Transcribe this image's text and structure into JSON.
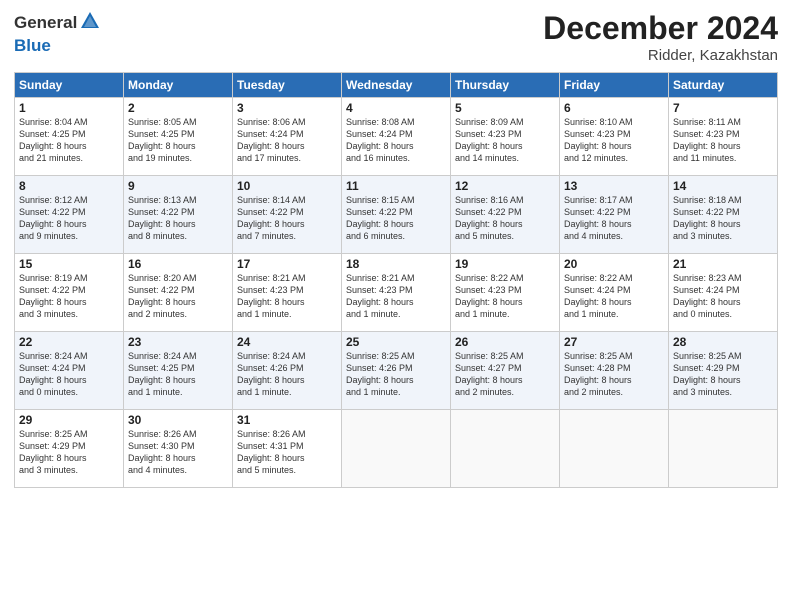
{
  "header": {
    "logo_line1": "General",
    "logo_line2": "Blue",
    "month": "December 2024",
    "location": "Ridder, Kazakhstan"
  },
  "weekdays": [
    "Sunday",
    "Monday",
    "Tuesday",
    "Wednesday",
    "Thursday",
    "Friday",
    "Saturday"
  ],
  "weeks": [
    [
      {
        "day": "1",
        "info": "Sunrise: 8:04 AM\nSunset: 4:25 PM\nDaylight: 8 hours\nand 21 minutes."
      },
      {
        "day": "2",
        "info": "Sunrise: 8:05 AM\nSunset: 4:25 PM\nDaylight: 8 hours\nand 19 minutes."
      },
      {
        "day": "3",
        "info": "Sunrise: 8:06 AM\nSunset: 4:24 PM\nDaylight: 8 hours\nand 17 minutes."
      },
      {
        "day": "4",
        "info": "Sunrise: 8:08 AM\nSunset: 4:24 PM\nDaylight: 8 hours\nand 16 minutes."
      },
      {
        "day": "5",
        "info": "Sunrise: 8:09 AM\nSunset: 4:23 PM\nDaylight: 8 hours\nand 14 minutes."
      },
      {
        "day": "6",
        "info": "Sunrise: 8:10 AM\nSunset: 4:23 PM\nDaylight: 8 hours\nand 12 minutes."
      },
      {
        "day": "7",
        "info": "Sunrise: 8:11 AM\nSunset: 4:23 PM\nDaylight: 8 hours\nand 11 minutes."
      }
    ],
    [
      {
        "day": "8",
        "info": "Sunrise: 8:12 AM\nSunset: 4:22 PM\nDaylight: 8 hours\nand 9 minutes."
      },
      {
        "day": "9",
        "info": "Sunrise: 8:13 AM\nSunset: 4:22 PM\nDaylight: 8 hours\nand 8 minutes."
      },
      {
        "day": "10",
        "info": "Sunrise: 8:14 AM\nSunset: 4:22 PM\nDaylight: 8 hours\nand 7 minutes."
      },
      {
        "day": "11",
        "info": "Sunrise: 8:15 AM\nSunset: 4:22 PM\nDaylight: 8 hours\nand 6 minutes."
      },
      {
        "day": "12",
        "info": "Sunrise: 8:16 AM\nSunset: 4:22 PM\nDaylight: 8 hours\nand 5 minutes."
      },
      {
        "day": "13",
        "info": "Sunrise: 8:17 AM\nSunset: 4:22 PM\nDaylight: 8 hours\nand 4 minutes."
      },
      {
        "day": "14",
        "info": "Sunrise: 8:18 AM\nSunset: 4:22 PM\nDaylight: 8 hours\nand 3 minutes."
      }
    ],
    [
      {
        "day": "15",
        "info": "Sunrise: 8:19 AM\nSunset: 4:22 PM\nDaylight: 8 hours\nand 3 minutes."
      },
      {
        "day": "16",
        "info": "Sunrise: 8:20 AM\nSunset: 4:22 PM\nDaylight: 8 hours\nand 2 minutes."
      },
      {
        "day": "17",
        "info": "Sunrise: 8:21 AM\nSunset: 4:23 PM\nDaylight: 8 hours\nand 1 minute."
      },
      {
        "day": "18",
        "info": "Sunrise: 8:21 AM\nSunset: 4:23 PM\nDaylight: 8 hours\nand 1 minute."
      },
      {
        "day": "19",
        "info": "Sunrise: 8:22 AM\nSunset: 4:23 PM\nDaylight: 8 hours\nand 1 minute."
      },
      {
        "day": "20",
        "info": "Sunrise: 8:22 AM\nSunset: 4:24 PM\nDaylight: 8 hours\nand 1 minute."
      },
      {
        "day": "21",
        "info": "Sunrise: 8:23 AM\nSunset: 4:24 PM\nDaylight: 8 hours\nand 0 minutes."
      }
    ],
    [
      {
        "day": "22",
        "info": "Sunrise: 8:24 AM\nSunset: 4:24 PM\nDaylight: 8 hours\nand 0 minutes."
      },
      {
        "day": "23",
        "info": "Sunrise: 8:24 AM\nSunset: 4:25 PM\nDaylight: 8 hours\nand 1 minute."
      },
      {
        "day": "24",
        "info": "Sunrise: 8:24 AM\nSunset: 4:26 PM\nDaylight: 8 hours\nand 1 minute."
      },
      {
        "day": "25",
        "info": "Sunrise: 8:25 AM\nSunset: 4:26 PM\nDaylight: 8 hours\nand 1 minute."
      },
      {
        "day": "26",
        "info": "Sunrise: 8:25 AM\nSunset: 4:27 PM\nDaylight: 8 hours\nand 2 minutes."
      },
      {
        "day": "27",
        "info": "Sunrise: 8:25 AM\nSunset: 4:28 PM\nDaylight: 8 hours\nand 2 minutes."
      },
      {
        "day": "28",
        "info": "Sunrise: 8:25 AM\nSunset: 4:29 PM\nDaylight: 8 hours\nand 3 minutes."
      }
    ],
    [
      {
        "day": "29",
        "info": "Sunrise: 8:25 AM\nSunset: 4:29 PM\nDaylight: 8 hours\nand 3 minutes."
      },
      {
        "day": "30",
        "info": "Sunrise: 8:26 AM\nSunset: 4:30 PM\nDaylight: 8 hours\nand 4 minutes."
      },
      {
        "day": "31",
        "info": "Sunrise: 8:26 AM\nSunset: 4:31 PM\nDaylight: 8 hours\nand 5 minutes."
      },
      null,
      null,
      null,
      null
    ]
  ]
}
